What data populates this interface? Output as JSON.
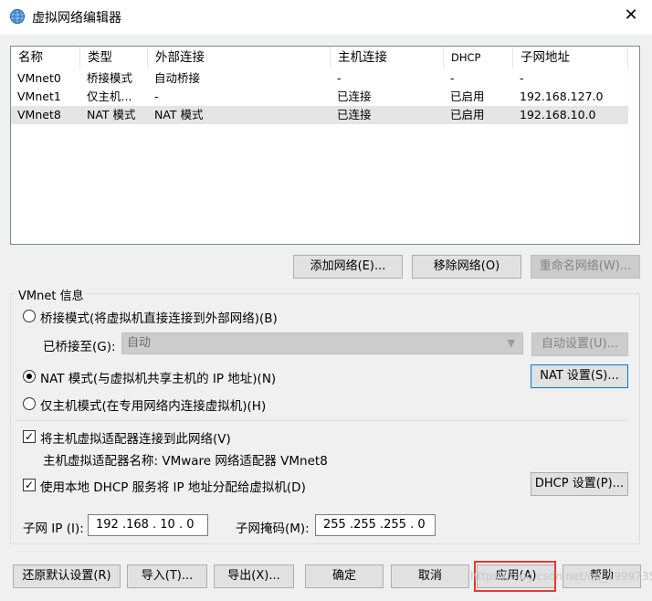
{
  "window": {
    "title": "虚拟网络编辑器",
    "close_glyph": "✕"
  },
  "table": {
    "headers": [
      "名称",
      "类型",
      "外部连接",
      "主机连接",
      "DHCP",
      "子网地址"
    ],
    "rows": [
      [
        "VMnet0",
        "桥接模式",
        "自动桥接",
        "-",
        "-",
        "-"
      ],
      [
        "VMnet1",
        "仅主机...",
        "-",
        "已连接",
        "已启用",
        "192.168.127.0"
      ],
      [
        "VMnet8",
        "NAT 模式",
        "NAT 模式",
        "已连接",
        "已启用",
        "192.168.10.0"
      ]
    ],
    "selected_row": 2
  },
  "list_buttons": {
    "add": "添加网络(E)...",
    "remove": "移除网络(O)",
    "rename": "重命名网络(W)..."
  },
  "vmnet_info": {
    "group_label": "VMnet 信息",
    "bridged_radio": "桥接模式(将虚拟机直接连接到外部网络)(B)",
    "bridged_to_label": "已桥接至(G):",
    "bridged_to_value": "自动",
    "auto_settings": "自动设置(U)...",
    "nat_radio": "NAT 模式(与虚拟机共享主机的 IP 地址)(N)",
    "nat_settings": "NAT 设置(S)...",
    "hostonly_radio": "仅主机模式(在专用网络内连接虚拟机)(H)",
    "connect_adapter_check": "将主机虚拟适配器连接到此网络(V)",
    "adapter_name_label": "主机虚拟适配器名称: VMware 网络适配器 VMnet8",
    "dhcp_check": "使用本地 DHCP 服务将 IP 地址分配给虚拟机(D)",
    "dhcp_settings": "DHCP 设置(P)...",
    "subnet_ip_label": "子网 IP (I):",
    "subnet_ip_value": "192 .168 . 10  .  0",
    "subnet_mask_label": "子网掩码(M):",
    "subnet_mask_value": "255 .255 .255 .  0",
    "selected_mode": "nat",
    "connect_adapter_checked": true,
    "dhcp_checked": true
  },
  "footer_buttons": {
    "restore": "还原默认设置(R)",
    "import": "导入(T)...",
    "export": "导出(X)...",
    "ok": "确定",
    "cancel": "取消",
    "apply": "应用(A)",
    "help": "帮助"
  },
  "watermark": "https://blog.csdn.net/qq_1999735",
  "colors": {
    "highlight_border": "#e53935",
    "focus_border": "#0078d7",
    "selected_row": "#e5e5e5"
  }
}
